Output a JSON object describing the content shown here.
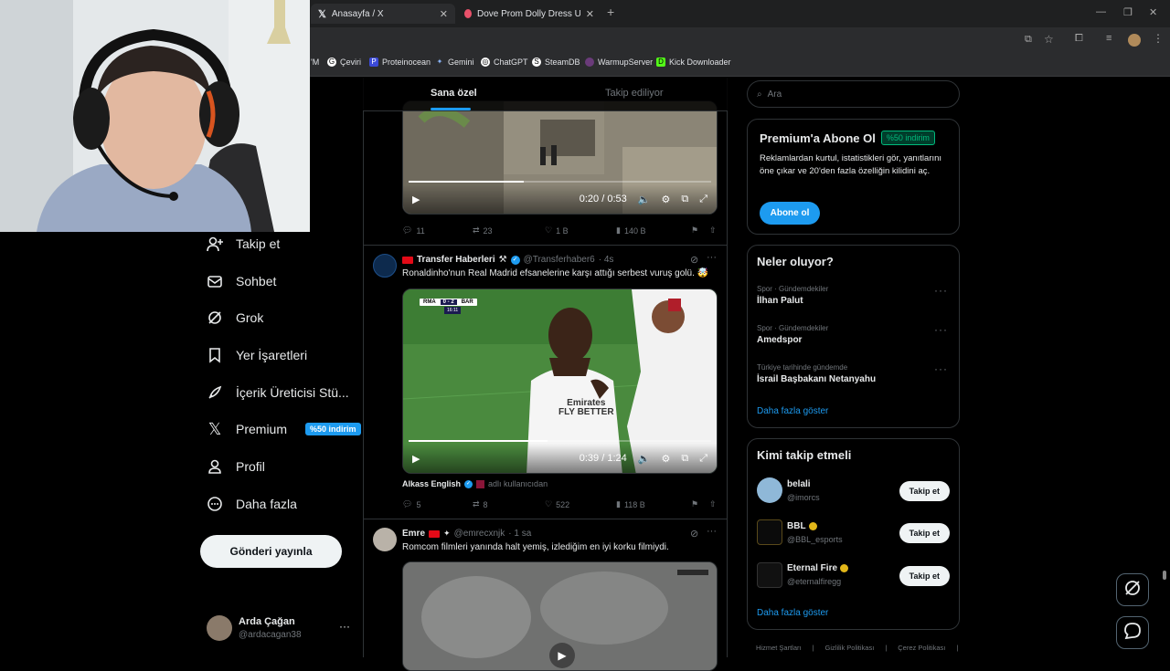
{
  "browser": {
    "tabs": [
      {
        "title": "Anasayfa / X",
        "icon": "x-logo-icon"
      },
      {
        "title": "Dove Prom Dolly Dress Up - Oy",
        "icon": "game-icon"
      }
    ],
    "bookmarks": [
      "'M",
      "Çeviri",
      "Proteinocean",
      "Gemini",
      "ChatGPT",
      "SteamDB",
      "WarmupServer",
      "Kick Downloader"
    ]
  },
  "feed_tabs": {
    "for_you": "Sana özel",
    "following": "Takip ediliyor"
  },
  "nav": {
    "items": [
      {
        "label": "Takip et",
        "icon": "add-user-icon"
      },
      {
        "label": "Sohbet",
        "icon": "mail-icon"
      },
      {
        "label": "Grok",
        "icon": "grok-icon"
      },
      {
        "label": "Yer İşaretleri",
        "icon": "bookmark-icon"
      },
      {
        "label": "İçerik Üreticisi Stü...",
        "icon": "rocket-icon"
      },
      {
        "label": "Premium",
        "icon": "x-logo-icon"
      },
      {
        "label": "Profil",
        "icon": "person-icon"
      },
      {
        "label": "Daha fazla",
        "icon": "more-circle-icon"
      }
    ],
    "premium_badge": "%50 indirim",
    "post_button": "Gönderi yayınla",
    "account": {
      "name": "Arda Çağan",
      "handle": "@ardacagan38"
    }
  },
  "posts": [
    {
      "video_time": "0:20 / 0:53",
      "video_progress": 0.38,
      "stats": {
        "replies": "11",
        "reposts": "23",
        "likes": "1 B",
        "views": "140 B"
      }
    },
    {
      "author": "Transfer Haberleri",
      "author_suffix": "⚒",
      "handle": "@Transferhaber6",
      "time": "· 4s",
      "text": "Ronaldinho'nun Real Madrid efsanelerine karşı attığı serbest vuruş golü. 🤯",
      "scoreboard": {
        "home": "RMA",
        "score": "0 - 2",
        "away": "BAR",
        "clock": "16:11"
      },
      "shirt_text": "Emirates\nFLY BETTER",
      "video_time": "0:39 / 1:24",
      "video_progress": 0.46,
      "credit_name": "Alkass English",
      "credit_suffix": "adlı kullanıcıdan",
      "stats": {
        "replies": "5",
        "reposts": "8",
        "likes": "522",
        "views": "118 B"
      }
    },
    {
      "author": "Emre",
      "handle": "@emrecxnjk",
      "time": "· 1 sa",
      "text": "Romcom filmleri yanında halt yemiş, izlediğim en iyi korku filmiydi."
    }
  ],
  "search": {
    "placeholder": "Ara"
  },
  "premium": {
    "title": "Premium'a Abone Ol",
    "badge": "%50 indirim",
    "body": "Reklamlardan kurtul, istatistikleri gör, yanıtlarını öne çıkar ve 20'den fazla özelliğin kilidini aç.",
    "button": "Abone ol"
  },
  "trends": {
    "title": "Neler oluyor?",
    "items": [
      {
        "meta": "Spor · Gündemdekiler",
        "name": "İlhan Palut"
      },
      {
        "meta": "Spor · Gündemdekiler",
        "name": "Amedspor"
      },
      {
        "meta": "Türkiye tarihinde gündemde",
        "name": "İsrail Başbakanı Netanyahu"
      }
    ],
    "more": "Daha fazla göster"
  },
  "who_to_follow": {
    "title": "Kimi takip etmeli",
    "items": [
      {
        "name": "belali",
        "handle": "@imorcs",
        "verified": false
      },
      {
        "name": "BBL",
        "handle": "@BBL_esports",
        "verified": true
      },
      {
        "name": "Eternal Fire",
        "handle": "@eternalfiregg",
        "verified": true
      }
    ],
    "button": "Takip et",
    "more": "Daha fazla göster"
  },
  "footer": [
    "Hizmet Şartları",
    "Gizlilik Politikası",
    "Çerez Politikası"
  ],
  "colors": {
    "accent": "#1d9bf0",
    "background": "#000000",
    "border": "#2f3336",
    "muted": "#71767b",
    "verified_gold": "#e2b719",
    "premium_green": "#00ba7c"
  }
}
